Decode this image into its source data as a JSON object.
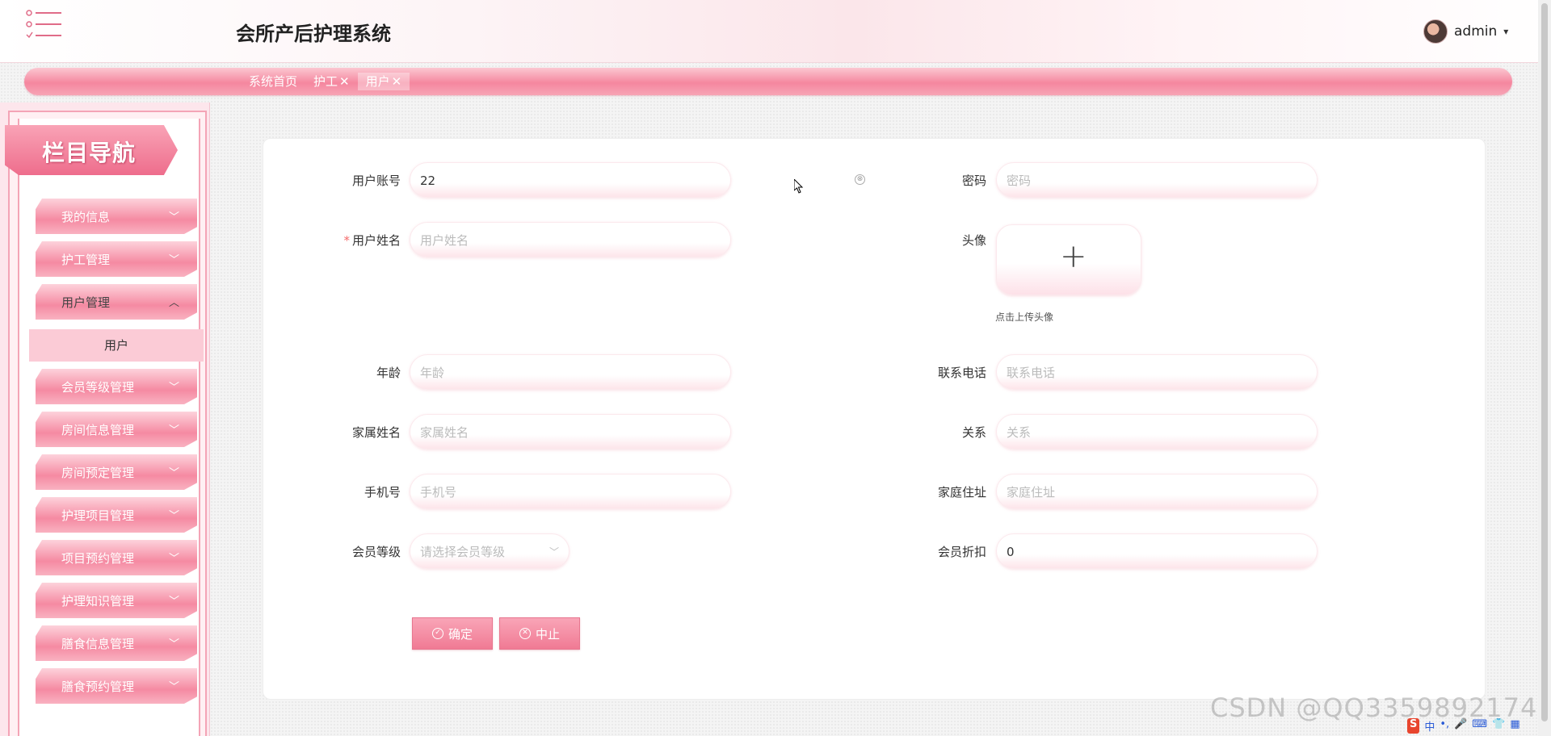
{
  "header": {
    "app_title": "会所产后护理系统",
    "username": "admin",
    "caret": "▾"
  },
  "tabs": [
    {
      "label": "系统首页",
      "closable": false,
      "active": false
    },
    {
      "label": "护工",
      "closable": true,
      "active": false
    },
    {
      "label": "用户",
      "closable": true,
      "active": true
    }
  ],
  "sidebar": {
    "banner_label": "栏目导航",
    "items": [
      {
        "label": "我的信息",
        "chevron": "﹀",
        "open": false
      },
      {
        "label": "护工管理",
        "chevron": "﹀",
        "open": false
      },
      {
        "label": "用户管理",
        "chevron": "︿",
        "open": true
      },
      {
        "label": "会员等级管理",
        "chevron": "﹀",
        "open": false
      },
      {
        "label": "房间信息管理",
        "chevron": "﹀",
        "open": false
      },
      {
        "label": "房间预定管理",
        "chevron": "﹀",
        "open": false
      },
      {
        "label": "护理项目管理",
        "chevron": "﹀",
        "open": false
      },
      {
        "label": "项目预约管理",
        "chevron": "﹀",
        "open": false
      },
      {
        "label": "护理知识管理",
        "chevron": "﹀",
        "open": false
      },
      {
        "label": "膳食信息管理",
        "chevron": "﹀",
        "open": false
      },
      {
        "label": "膳食预约管理",
        "chevron": "﹀",
        "open": false
      }
    ],
    "sub_item": "用户"
  },
  "form": {
    "account": {
      "label": "用户账号",
      "value": "22"
    },
    "password": {
      "label": "密码",
      "placeholder": "密码"
    },
    "name": {
      "label": "用户姓名",
      "placeholder": "用户姓名",
      "required": "*"
    },
    "avatar": {
      "label": "头像",
      "plus": "+",
      "hint": "点击上传头像"
    },
    "age": {
      "label": "年龄",
      "placeholder": "年龄"
    },
    "phone": {
      "label": "联系电话",
      "placeholder": "联系电话"
    },
    "family_name": {
      "label": "家属姓名",
      "placeholder": "家属姓名"
    },
    "relation": {
      "label": "关系",
      "placeholder": "关系"
    },
    "mobile": {
      "label": "手机号",
      "placeholder": "手机号"
    },
    "address": {
      "label": "家庭住址",
      "placeholder": "家庭住址"
    },
    "member_level": {
      "label": "会员等级",
      "placeholder": "请选择会员等级",
      "arrow": "﹀"
    },
    "discount": {
      "label": "会员折扣",
      "value": "0"
    },
    "clear_glyph": "⊗",
    "confirm_button": "确定",
    "cancel_button": "中止",
    "confirm_glyph": "✓",
    "cancel_glyph": "✕"
  },
  "watermark": "CSDN @QQ3359892174",
  "tray": {
    "ime": "S",
    "lang": "中"
  },
  "colors": {
    "accent": "#f07a94",
    "accent_light": "#fbc7d1",
    "sidebar_bg": "#fde6ec"
  }
}
